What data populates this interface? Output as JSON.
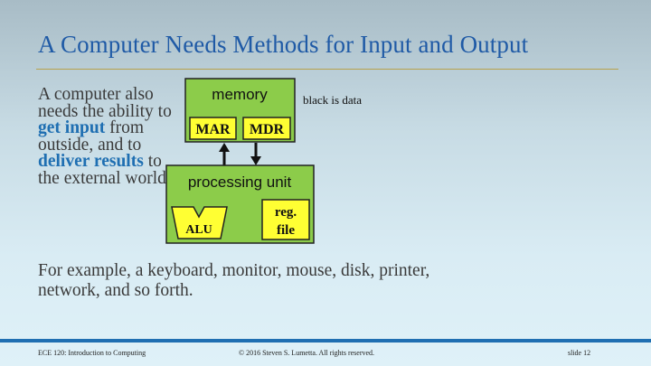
{
  "slide": {
    "title": "A Computer Needs Methods for Input and Output",
    "intro_parts": [
      "A computer also needs the ability to ",
      "get input",
      " from outside, and to ",
      "deliver results",
      " to the external world."
    ],
    "example": "For example, a keyboard, monitor, mouse, disk, printer, network, and so forth."
  },
  "diagram": {
    "memory_label": "memory",
    "mar_label": "MAR",
    "mdr_label": "MDR",
    "processing_label": "processing unit",
    "alu_label": "ALU",
    "reg_line1": "reg.",
    "reg_line2": "file",
    "note": "black is data"
  },
  "footer": {
    "course": "ECE 120: Introduction to Computing",
    "copyright": "© 2016 Steven S. Lumetta.  All rights reserved.",
    "slide_number": "slide 12"
  },
  "colors": {
    "title": "#1f5aa6",
    "emphasis": "#1f6fb2",
    "box_green": "#8ccc4a",
    "register_yellow": "#ffff33",
    "rule_gold": "#b7a24c"
  }
}
